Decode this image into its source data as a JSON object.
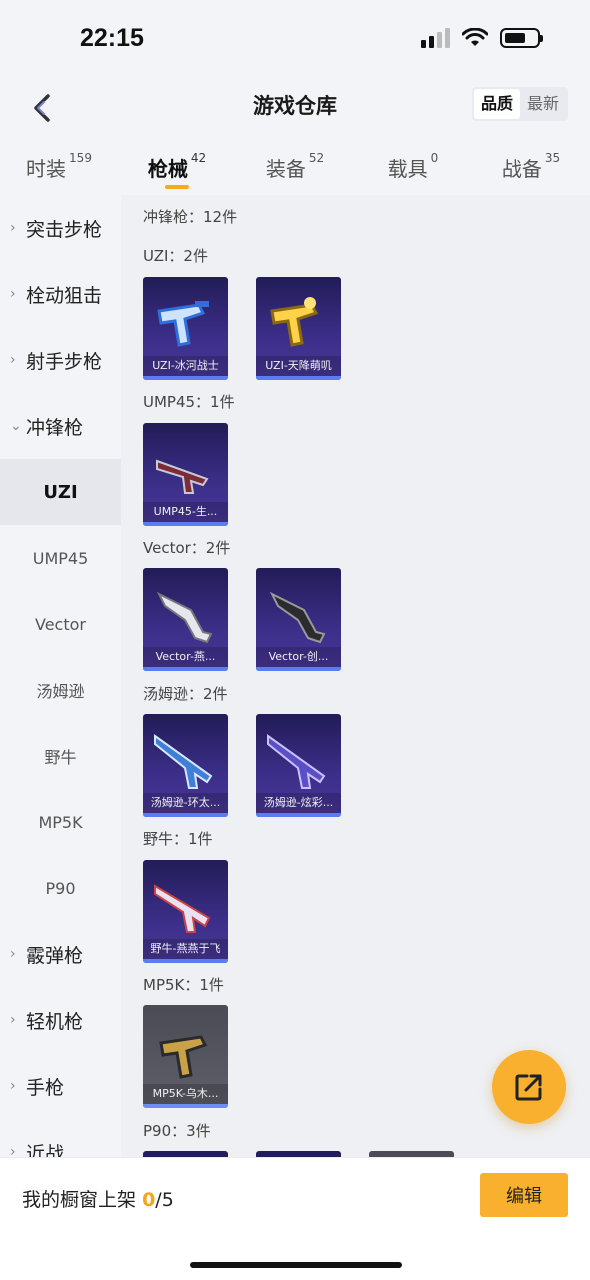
{
  "status": {
    "time": "22:15"
  },
  "header": {
    "title": "游戏仓库",
    "sort_options": [
      "品质",
      "最新"
    ]
  },
  "tabs": [
    {
      "label": "时装",
      "count": "159"
    },
    {
      "label": "枪械",
      "count": "42"
    },
    {
      "label": "装备",
      "count": "52"
    },
    {
      "label": "载具",
      "count": "0"
    },
    {
      "label": "战备",
      "count": "35"
    }
  ],
  "sidebar": {
    "items": [
      {
        "label": "突击步枪",
        "type": "parent",
        "chevron": "›"
      },
      {
        "label": "栓动狙击",
        "type": "parent",
        "chevron": "›"
      },
      {
        "label": "射手步枪",
        "type": "parent",
        "chevron": "›"
      },
      {
        "label": "冲锋枪",
        "type": "parent",
        "chevron": "⌄"
      },
      {
        "label": "UZI",
        "type": "child",
        "active": true
      },
      {
        "label": "UMP45",
        "type": "child"
      },
      {
        "label": "Vector",
        "type": "child"
      },
      {
        "label": "汤姆逊",
        "type": "child"
      },
      {
        "label": "野牛",
        "type": "child"
      },
      {
        "label": "MP5K",
        "type": "child"
      },
      {
        "label": "P90",
        "type": "child"
      },
      {
        "label": "霰弹枪",
        "type": "parent",
        "chevron": "›"
      },
      {
        "label": "轻机枪",
        "type": "parent",
        "chevron": "›"
      },
      {
        "label": "手枪",
        "type": "parent",
        "chevron": "›"
      },
      {
        "label": "近战",
        "type": "parent",
        "chevron": "›"
      }
    ]
  },
  "main": {
    "header": "冲锋枪：12件",
    "groups": [
      {
        "label": "UZI：2件",
        "items": [
          "UZI-冰河战士",
          "UZI-天降萌叽"
        ]
      },
      {
        "label": "UMP45：1件",
        "items": [
          "UMP45-生..."
        ]
      },
      {
        "label": "Vector：2件",
        "items": [
          "Vector-燕...",
          "Vector-创..."
        ]
      },
      {
        "label": "汤姆逊：2件",
        "items": [
          "汤姆逊-环太...",
          "汤姆逊-炫彩..."
        ]
      },
      {
        "label": "野牛：1件",
        "items": [
          "野牛-燕燕于飞"
        ]
      },
      {
        "label": "MP5K：1件",
        "items": [
          "MP5K-乌木..."
        ]
      },
      {
        "label": "P90：3件",
        "items": [
          "",
          "",
          ""
        ]
      }
    ]
  },
  "bottom": {
    "label": "我的橱窗上架",
    "count_used": "0",
    "count_total": "/5",
    "edit_label": "编辑"
  },
  "colors": {
    "accent": "#f8b02e",
    "card_bg": "#2e2470",
    "card_bar": "#5b7cf3"
  },
  "icons": {
    "back": "chevron-left-icon",
    "fab": "share-out-icon"
  }
}
